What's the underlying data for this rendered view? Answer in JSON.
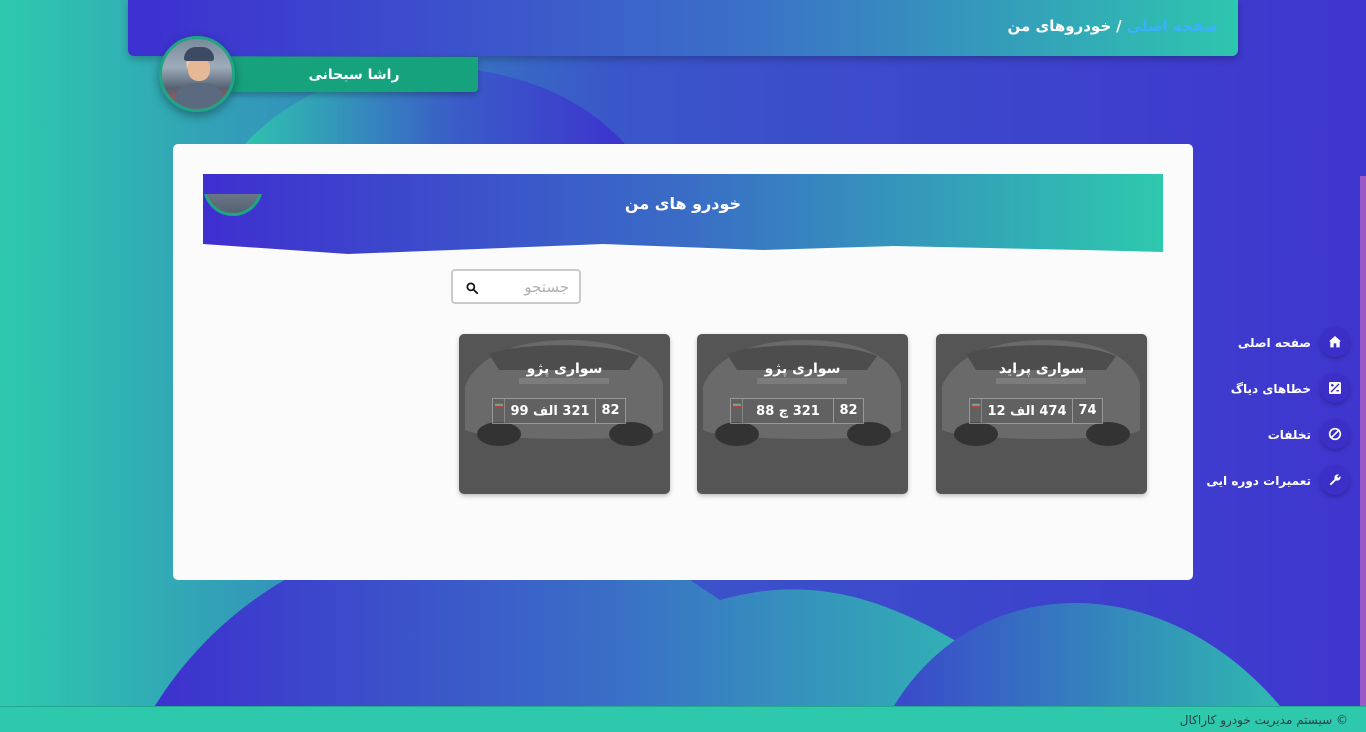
{
  "breadcrumb": {
    "home": "صفحه اصلی",
    "separator": "/",
    "current": "خودروهای من"
  },
  "user": {
    "name": "راشا سبحانی"
  },
  "card": {
    "title": "خودرو های من"
  },
  "search": {
    "placeholder": "جستجو",
    "value": ""
  },
  "cars": [
    {
      "title": "سواری پراید",
      "plate_main": "474 الف 12",
      "plate_code": "74"
    },
    {
      "title": "سواری پژو",
      "plate_main": "321 چ 88",
      "plate_code": "82"
    },
    {
      "title": "سواری پژو",
      "plate_main": "321 الف 99",
      "plate_code": "82"
    }
  ],
  "sidenav": [
    {
      "label": "صفحه اصلی",
      "icon": "home-icon"
    },
    {
      "label": "خطاهای دیاگ",
      "icon": "diagnostic-icon"
    },
    {
      "label": "تخلفات",
      "icon": "block-icon"
    },
    {
      "label": "تعمیرات دوره ایی",
      "icon": "wrench-icon"
    }
  ],
  "footer": {
    "text": "© سیستم مدیریت خودرو کاراکال"
  },
  "colors": {
    "accent_teal": "#2ec9ad",
    "accent_indigo": "#3f35cf",
    "user_tag": "#17a27e",
    "breadcrumb_link": "#3ab0ff",
    "tile_bg": "#555555"
  }
}
